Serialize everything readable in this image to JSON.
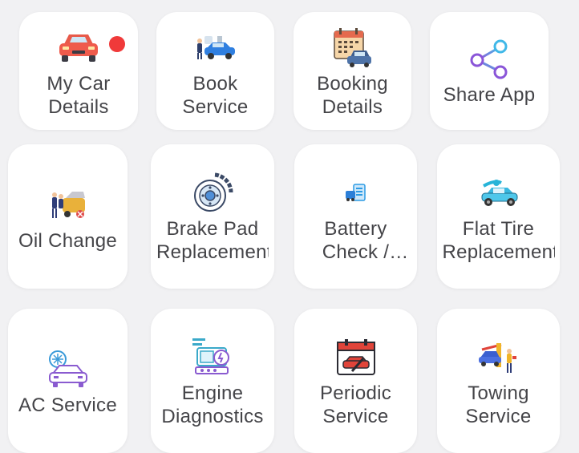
{
  "colors": {
    "background": "#f1f1f3",
    "card": "#ffffff",
    "label": "#444448",
    "badge": "#f03a3a"
  },
  "top_row": [
    {
      "label": "My Car Details",
      "icon": "red-car-icon",
      "badge": true
    },
    {
      "label": "Book Service",
      "icon": "mechanic-car-icon"
    },
    {
      "label": "Booking Details",
      "icon": "calendar-car-icon"
    },
    {
      "label": "Share App",
      "icon": "share-icon"
    }
  ],
  "services": [
    {
      "label": "Oil Change",
      "icon": "oil-change-icon"
    },
    {
      "label": "Brake Pad Replacement",
      "icon": "brake-disc-icon"
    },
    {
      "label": "Battery Check / Replacement",
      "icon": "battery-icon"
    },
    {
      "label": "Flat Tire Replacement",
      "icon": "flat-tire-icon"
    },
    {
      "label": "AC Service",
      "icon": "ac-car-icon"
    },
    {
      "label": "Engine Diagnostics",
      "icon": "engine-diagnostic-icon"
    },
    {
      "label": "Periodic Service",
      "icon": "calendar-wrench-icon"
    },
    {
      "label": "Towing Service",
      "icon": "towing-icon"
    }
  ]
}
